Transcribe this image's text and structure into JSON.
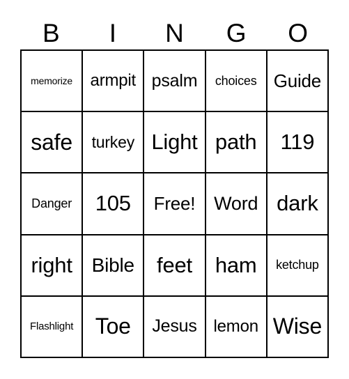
{
  "header": [
    "B",
    "I",
    "N",
    "G",
    "O"
  ],
  "cells": [
    [
      "memorize",
      "armpit",
      "psalm",
      "choices",
      "Guide"
    ],
    [
      "safe",
      "turkey",
      "Light",
      "path",
      "119"
    ],
    [
      "Danger",
      "105",
      "Free!",
      "Word",
      "dark"
    ],
    [
      "right",
      "Bible",
      "feet",
      "ham",
      "ketchup"
    ],
    [
      "Flashlight",
      "Toe",
      "Jesus",
      "lemon",
      "Wise"
    ]
  ]
}
